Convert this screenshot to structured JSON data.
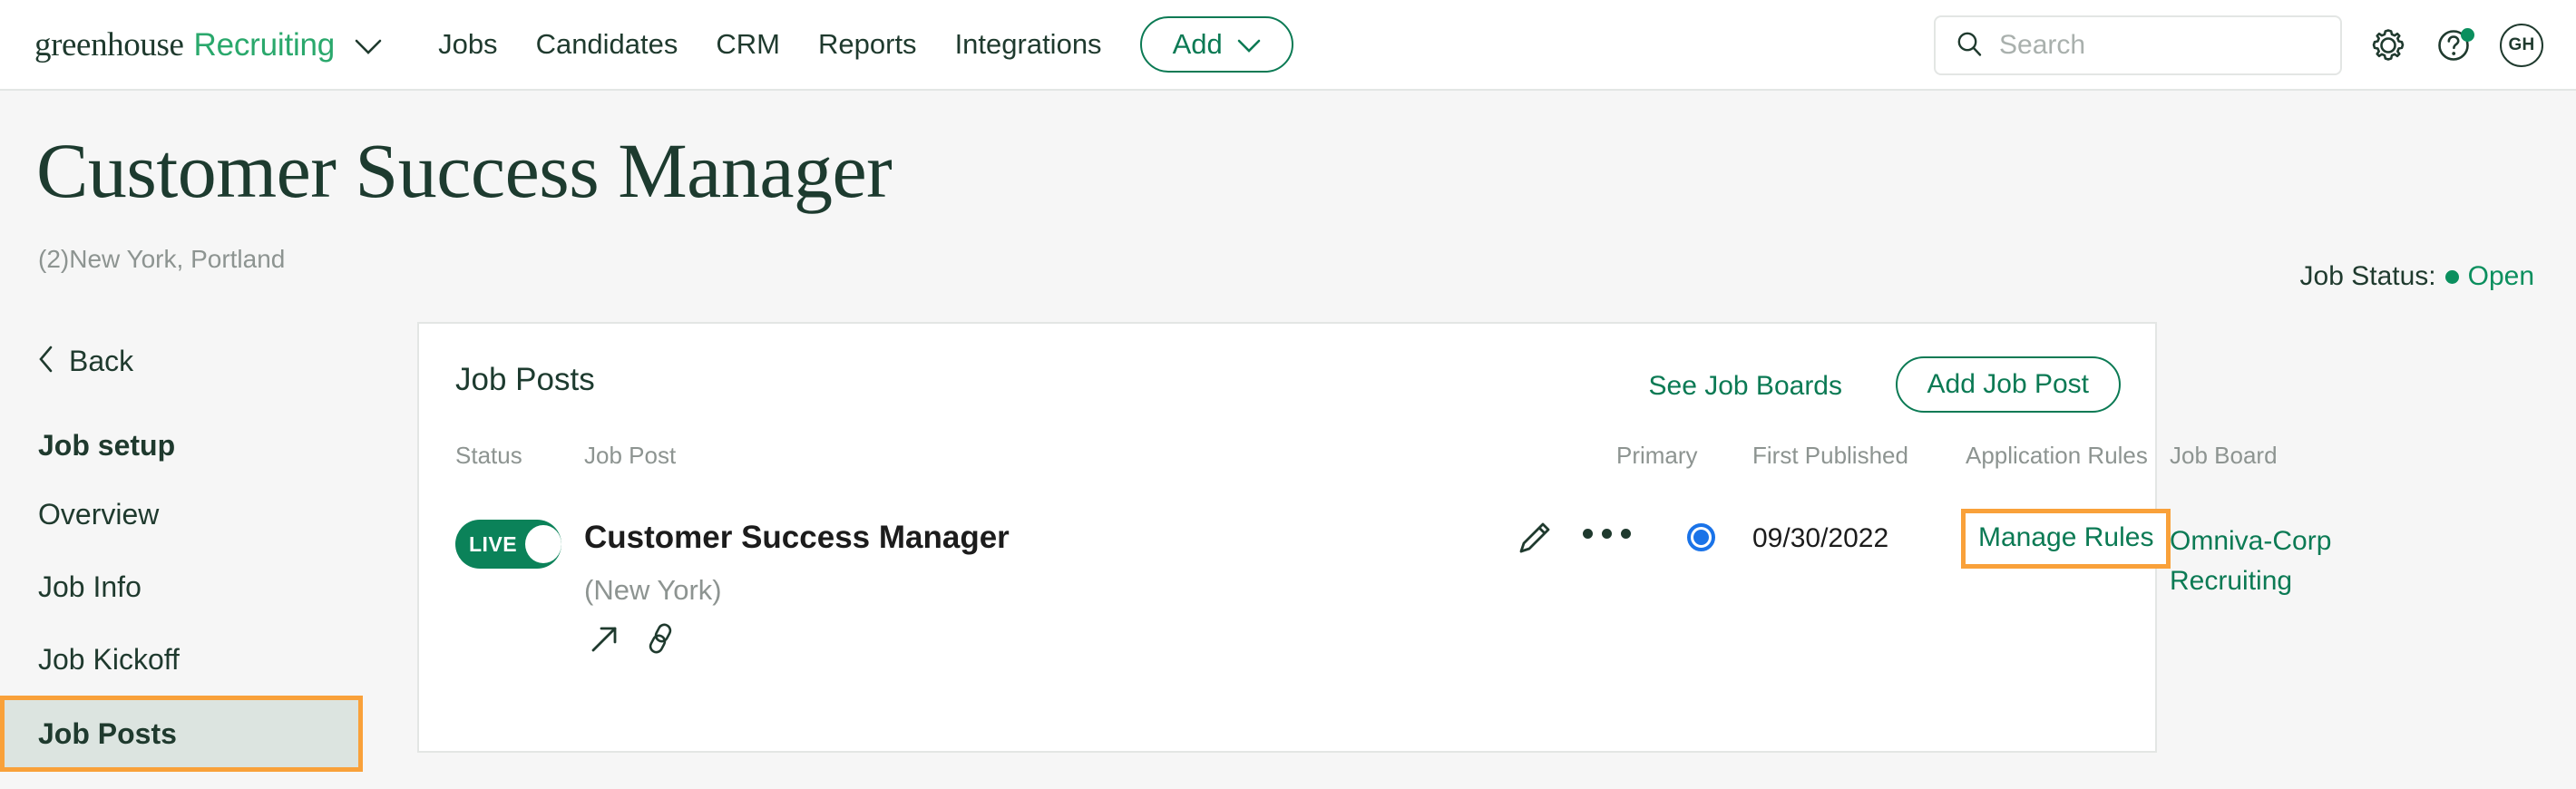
{
  "topnav": {
    "brand_primary": "greenhouse",
    "brand_secondary": "Recruiting",
    "brand_caret_icon": "chevron-down-icon",
    "links": [
      {
        "label": "Jobs"
      },
      {
        "label": "Candidates"
      },
      {
        "label": "CRM"
      },
      {
        "label": "Reports"
      },
      {
        "label": "Integrations"
      }
    ],
    "add_button": {
      "label": "Add",
      "icon": "chevron-down-icon"
    },
    "search": {
      "value": "",
      "placeholder": "Search",
      "icon": "search-icon"
    },
    "settings_icon": "gear-icon",
    "help_icon": "question-mark-icon",
    "avatar": {
      "initials": "GH"
    }
  },
  "page": {
    "title": "Customer Success Manager",
    "locations": "(2)New York, Portland",
    "status_label": "Job Status:",
    "status_value": "Open"
  },
  "sidebar": {
    "back": {
      "label": "Back",
      "icon": "chevron-left-icon"
    },
    "items": [
      {
        "label": "Job setup",
        "type": "section"
      },
      {
        "label": "Overview",
        "type": "item"
      },
      {
        "label": "Job Info",
        "type": "item"
      },
      {
        "label": "Job Kickoff",
        "type": "item"
      },
      {
        "label": "Job Posts",
        "type": "item-active"
      }
    ]
  },
  "card": {
    "title": "Job Posts",
    "see_job_boards": "See Job Boards",
    "add_job_post": "Add Job Post",
    "columns": {
      "status": "Status",
      "job_post": "Job Post",
      "primary": "Primary",
      "first_published": "First Published",
      "application_rules": "Application Rules",
      "job_board": "Job Board"
    },
    "rows": [
      {
        "status_toggle": "LIVE",
        "post_name": "Customer Success Manager",
        "post_location": "(New York)",
        "post_icons": [
          "external-link-icon",
          "chain-link-icon"
        ],
        "edit_icon": "pencil-icon",
        "more_icon": "ellipsis-icon",
        "primary_selected": true,
        "first_published": "09/30/2022",
        "application_rules": "Manage Rules",
        "job_board": "Omniva-Corp Recruiting"
      }
    ]
  },
  "colors": {
    "brand_green": "#0b7a54",
    "accent_green": "#0b8f5e",
    "dark_green": "#1f3a2e",
    "highlight_orange": "#f9a13a",
    "radio_blue": "#1a73e8",
    "page_bg": "#f6f6f6",
    "active_nav_bg": "#dce4e0"
  }
}
